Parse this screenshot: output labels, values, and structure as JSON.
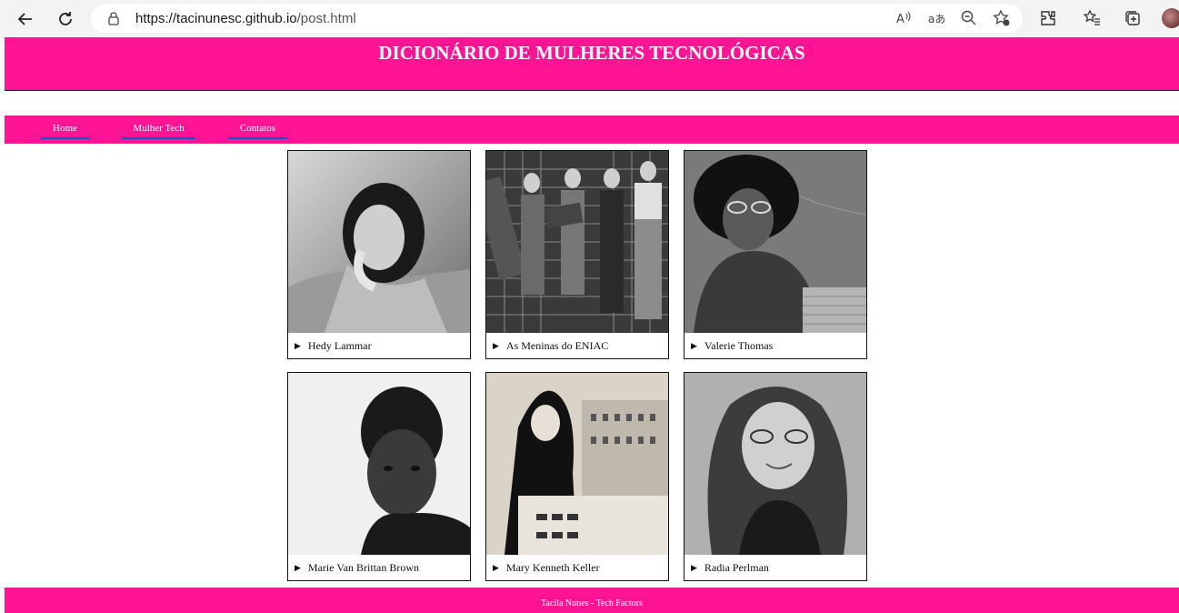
{
  "browser": {
    "url_host": "https://tacinunesc.github.io",
    "url_path": "/post.html"
  },
  "header": {
    "title": "DICIONÁRIO DE MULHERES TECNOLÓGICAS"
  },
  "nav": {
    "items": [
      {
        "label": "Home"
      },
      {
        "label": "Mulher Tech"
      },
      {
        "label": "Contatos"
      }
    ]
  },
  "cards": [
    {
      "name": "Hedy Lammar"
    },
    {
      "name": "As Meninas do ENIAC"
    },
    {
      "name": "Valerie Thomas"
    },
    {
      "name": "Marie Van Brittan Brown"
    },
    {
      "name": "Mary Kenneth Keller"
    },
    {
      "name": "Radia Perlman"
    }
  ],
  "footer": {
    "text": "Tacila Nunes - Tech Factors"
  },
  "colors": {
    "accent": "#ff1493",
    "nav_underline": "#1f4fc4"
  },
  "icons": [
    "back-icon",
    "refresh-icon",
    "lock-icon",
    "read-aloud-icon",
    "translate-icon",
    "zoom-out-icon",
    "favorite-add-icon",
    "extensions-icon",
    "favorites-icon",
    "collections-icon",
    "profile-avatar",
    "disclosure-triangle-icon"
  ]
}
